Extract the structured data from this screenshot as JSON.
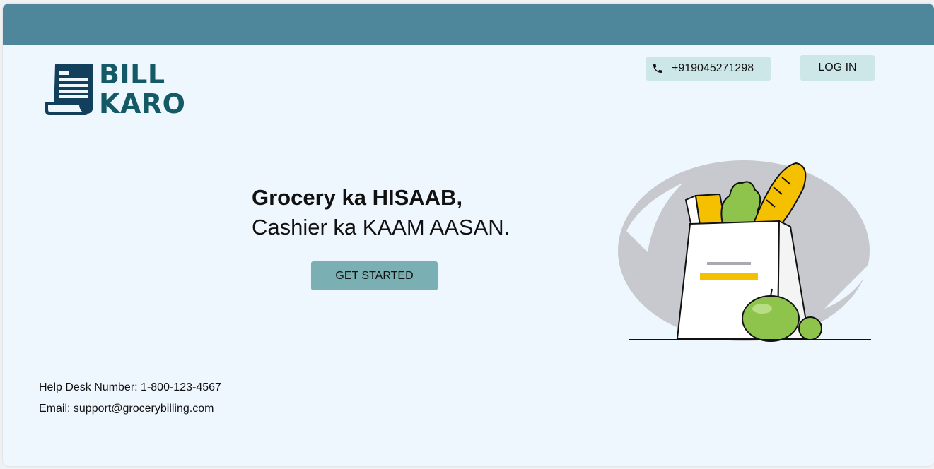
{
  "brand": {
    "line1": "BILL",
    "line2": "KARO"
  },
  "header": {
    "phone": "+919045271298",
    "login_label": "LOG IN"
  },
  "hero": {
    "line1": "Grocery ka HISAAB,",
    "line2": "Cashier ka KAAM AASAN.",
    "cta_label": "GET STARTED"
  },
  "contact": {
    "helpdesk": "Help Desk Number: 1-800-123-4567",
    "email": "Email: support@grocerybilling.com"
  },
  "icons": {
    "logo": "receipt-icon",
    "phone": "phone-icon",
    "illustration": "grocery-bag-illustration"
  },
  "colors": {
    "topbar": "#4e869c",
    "brand": "#145a66",
    "button_light": "#cde7e8",
    "button_cta": "#7ab0b3",
    "background": "#eef6fe"
  }
}
